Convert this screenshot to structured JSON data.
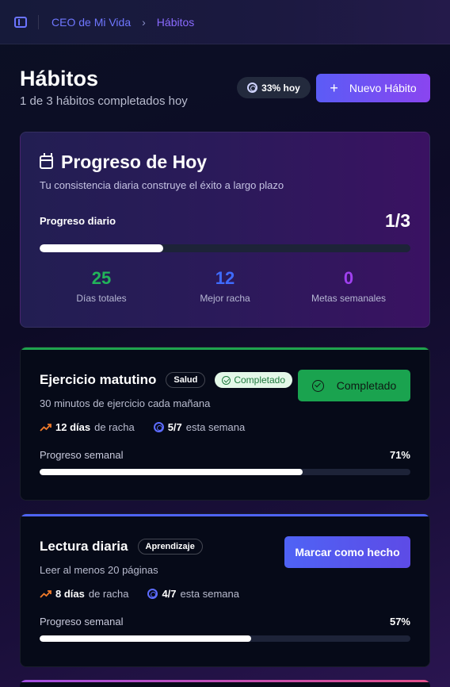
{
  "breadcrumb": {
    "root": "CEO de Mi Vida",
    "separator": "›",
    "current": "Hábitos"
  },
  "header": {
    "title": "Hábitos",
    "subtitle": "1 de 3 hábitos completados hoy",
    "today_badge": "33% hoy",
    "new_button": "Nuevo Hábito",
    "new_button_icon": "+"
  },
  "progress_card": {
    "title": "Progreso de Hoy",
    "subtitle": "Tu consistencia diaria construye el éxito a largo plazo",
    "daily_label": "Progreso diario",
    "daily_value": "1/3",
    "daily_fraction": 0.333,
    "stats": [
      {
        "value": "25",
        "label": "Días totales",
        "color": "#22b45a"
      },
      {
        "value": "12",
        "label": "Mejor racha",
        "color": "#3f6bff"
      },
      {
        "value": "0",
        "label": "Metas semanales",
        "color": "#a040f0"
      }
    ]
  },
  "habits": [
    {
      "name": "Ejercicio matutino",
      "category": "Salud",
      "status_badge": "Completado",
      "description": "30 minutos de ejercicio cada mañana",
      "streak_value": "12 días",
      "streak_suffix": "de racha",
      "week_value": "5/7",
      "week_suffix": "esta semana",
      "weekly_label": "Progreso semanal",
      "weekly_pct": "71%",
      "weekly_fraction": 0.71,
      "action_label": "Completado",
      "accent_color": "#1fa34f"
    },
    {
      "name": "Lectura diaria",
      "category": "Aprendizaje",
      "description": "Leer al menos 20 páginas",
      "streak_value": "8 días",
      "streak_suffix": "de racha",
      "week_value": "4/7",
      "week_suffix": "esta semana",
      "weekly_label": "Progreso semanal",
      "weekly_pct": "57%",
      "weekly_fraction": 0.57,
      "action_label": "Marcar como hecho",
      "accent_color": "#4f63f5"
    }
  ]
}
